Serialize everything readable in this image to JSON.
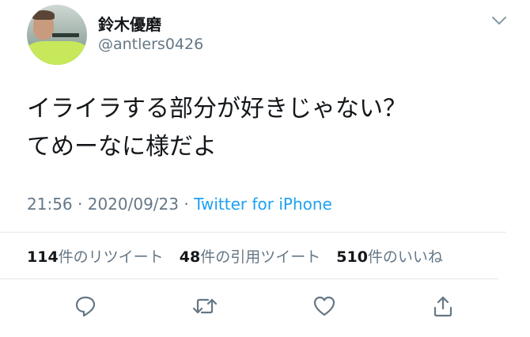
{
  "user": {
    "display_name": "鈴木優磨",
    "handle": "@antlers0426"
  },
  "tweet": {
    "lines": [
      "イライラする部分が好きじゃない？",
      "てめーなに様だよ"
    ],
    "time": "21:56",
    "separator1": " · ",
    "date": "2020/09/23",
    "separator2": " · ",
    "source": "Twitter for iPhone"
  },
  "stats": {
    "retweets": {
      "count": "114",
      "label": "件のリツイート"
    },
    "quotes": {
      "count": "48",
      "label": "件の引用ツイート"
    },
    "likes": {
      "count": "510",
      "label": "件のいいね"
    }
  },
  "icons": {
    "menu": "chevron-down-icon",
    "reply": "reply-icon",
    "retweet": "retweet-icon",
    "like": "heart-icon",
    "share": "share-icon"
  },
  "colors": {
    "text": "#14171a",
    "secondary": "#657786",
    "link": "#1da1f2",
    "divider": "#e1e8ed"
  }
}
